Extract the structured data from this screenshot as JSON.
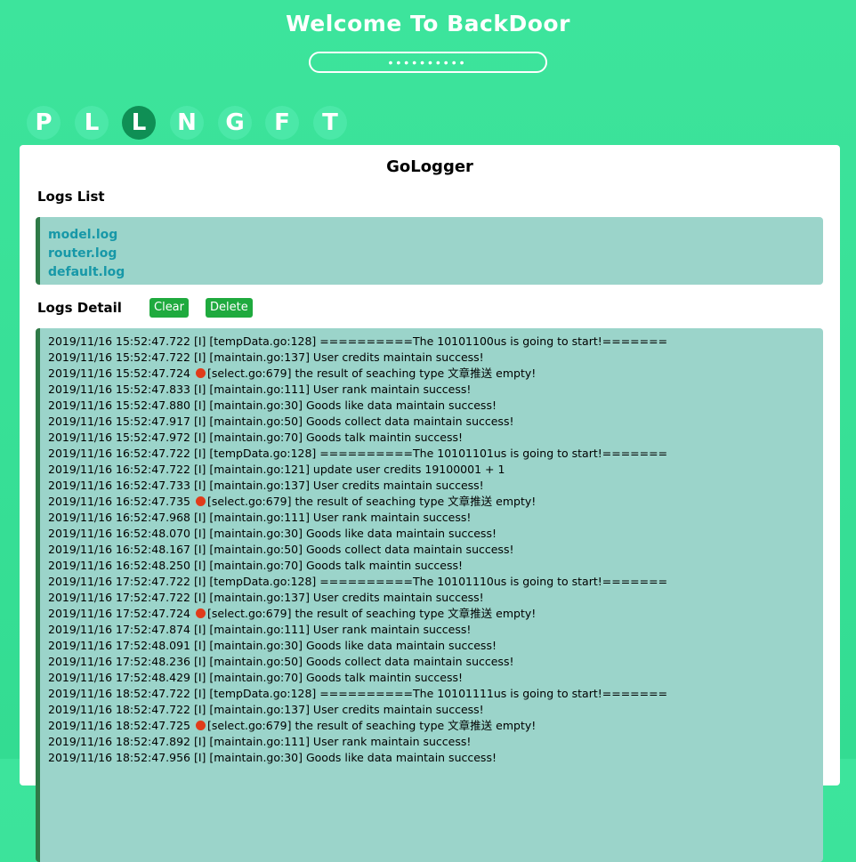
{
  "header": {
    "title": "Welcome To BackDoor",
    "password_value": "••••••••••"
  },
  "tabs": [
    {
      "label": "P",
      "active": false
    },
    {
      "label": "L",
      "active": false
    },
    {
      "label": "L",
      "active": true
    },
    {
      "label": "N",
      "active": false
    },
    {
      "label": "G",
      "active": false
    },
    {
      "label": "F",
      "active": false
    },
    {
      "label": "T",
      "active": false
    }
  ],
  "panel": {
    "title": "GoLogger",
    "logs_list_label": "Logs List",
    "log_files": [
      "model.log",
      "router.log",
      "default.log"
    ],
    "logs_detail_label": "Logs Detail",
    "clear_label": "Clear",
    "delete_label": "Delete"
  },
  "log_lines": [
    {
      "text": "2019/11/16 15:52:47.722 [I] [tempData.go:128]  ==========The  10101100us is going to start!=======",
      "icon": false
    },
    {
      "text": "2019/11/16 15:52:47.722 [I] [maintain.go:137]  User credits maintain success!",
      "icon": false
    },
    {
      "pre": "2019/11/16 15:52:47.724 ",
      "text": "[select.go:679]  the result of seaching type 文章推送 empty!",
      "icon": true
    },
    {
      "text": "2019/11/16 15:52:47.833 [I] [maintain.go:111]  User rank maintain success!",
      "icon": false
    },
    {
      "text": "2019/11/16 15:52:47.880 [I] [maintain.go:30]  Goods like data maintain success!",
      "icon": false
    },
    {
      "text": "2019/11/16 15:52:47.917 [I] [maintain.go:50]  Goods collect data maintain success!",
      "icon": false
    },
    {
      "text": "2019/11/16 15:52:47.972 [I] [maintain.go:70]  Goods talk maintin success!",
      "icon": false
    },
    {
      "text": "2019/11/16 16:52:47.722 [I] [tempData.go:128]  ==========The  10101101us is going to start!=======",
      "icon": false
    },
    {
      "text": "2019/11/16 16:52:47.722 [I] [maintain.go:121]  update user credits 19100001 + 1",
      "icon": false
    },
    {
      "text": "2019/11/16 16:52:47.733 [I] [maintain.go:137]  User credits maintain success!",
      "icon": false
    },
    {
      "pre": "2019/11/16 16:52:47.735 ",
      "text": "[select.go:679]  the result of seaching type 文章推送 empty!",
      "icon": true
    },
    {
      "text": "2019/11/16 16:52:47.968 [I] [maintain.go:111]  User rank maintain success!",
      "icon": false
    },
    {
      "text": "2019/11/16 16:52:48.070 [I] [maintain.go:30]  Goods like data maintain success!",
      "icon": false
    },
    {
      "text": "2019/11/16 16:52:48.167 [I] [maintain.go:50]  Goods collect data maintain success!",
      "icon": false
    },
    {
      "text": "2019/11/16 16:52:48.250 [I] [maintain.go:70]  Goods talk maintin success!",
      "icon": false
    },
    {
      "text": "2019/11/16 17:52:47.722 [I] [tempData.go:128]  ==========The  10101110us is going to start!=======",
      "icon": false
    },
    {
      "text": "2019/11/16 17:52:47.722 [I] [maintain.go:137]  User credits maintain success!",
      "icon": false
    },
    {
      "pre": "2019/11/16 17:52:47.724 ",
      "text": "[select.go:679]  the result of seaching type 文章推送 empty!",
      "icon": true
    },
    {
      "text": "2019/11/16 17:52:47.874 [I] [maintain.go:111]  User rank maintain success!",
      "icon": false
    },
    {
      "text": "2019/11/16 17:52:48.091 [I] [maintain.go:30]  Goods like data maintain success!",
      "icon": false
    },
    {
      "text": "2019/11/16 17:52:48.236 [I] [maintain.go:50]  Goods collect data maintain success!",
      "icon": false
    },
    {
      "text": "2019/11/16 17:52:48.429 [I] [maintain.go:70]  Goods talk maintin success!",
      "icon": false
    },
    {
      "text": "2019/11/16 18:52:47.722 [I] [tempData.go:128]  ==========The  10101111us is going to start!=======",
      "icon": false
    },
    {
      "text": "2019/11/16 18:52:47.722 [I] [maintain.go:137]  User credits maintain success!",
      "icon": false
    },
    {
      "pre": "2019/11/16 18:52:47.725 ",
      "text": "[select.go:679]  the result of seaching type 文章推送 empty!",
      "icon": true
    },
    {
      "text": "2019/11/16 18:52:47.892 [I] [maintain.go:111]  User rank maintain success!",
      "icon": false
    },
    {
      "text": "2019/11/16 18:52:47.956 [I] [maintain.go:30]  Goods like data maintain success!",
      "icon": false
    }
  ],
  "colors": {
    "background": "#3de49c",
    "tab_active": "#0f8f55",
    "log_panel": "#9bd4ca",
    "button": "#1faa3e",
    "file_link": "#1798a8"
  }
}
